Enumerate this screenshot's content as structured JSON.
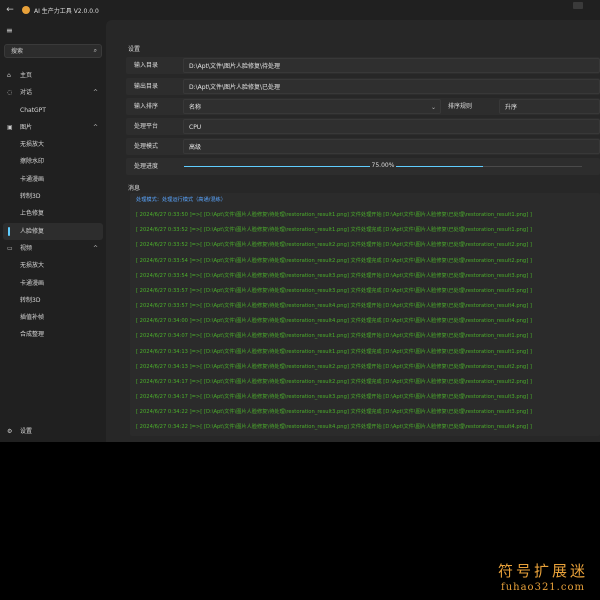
{
  "window": {
    "title": "AI 生产力工具 V2.0.0.0"
  },
  "sidebar": {
    "search_placeholder": "搜索",
    "items": [
      {
        "label": "主页",
        "icon": "home-icon"
      },
      {
        "label": "对话",
        "icon": "chat-icon"
      },
      {
        "label": "ChatGPT"
      },
      {
        "label": "图片",
        "icon": "image-icon"
      },
      {
        "label": "无损放大"
      },
      {
        "label": "擦除水印"
      },
      {
        "label": "卡通漫画"
      },
      {
        "label": "转制3D"
      },
      {
        "label": "上色修复"
      },
      {
        "label": "人脸修复"
      },
      {
        "label": "视频",
        "icon": "video-icon"
      },
      {
        "label": "无损放大"
      },
      {
        "label": "卡通漫画"
      },
      {
        "label": "转制3D"
      },
      {
        "label": "插值补帧"
      },
      {
        "label": "合成整理"
      }
    ],
    "settings_label": "设置"
  },
  "main": {
    "settings_title": "设置",
    "input_dir_label": "输入目录",
    "input_dir_value": "D:\\Apt\\文件\\图片人脸修复\\待处理",
    "output_dir_label": "输出目录",
    "output_dir_value": "D:\\Apt\\文件\\图片人脸修复\\已处理",
    "sort_label": "输入排序",
    "sort_value": "名称",
    "sort_rule_label": "排序规则",
    "sort_rule_value": "升序",
    "platform_label": "处理平台",
    "platform_value": "CPU",
    "mode_label": "处理模式",
    "mode_value": "高级",
    "progress_label": "处理进度",
    "progress_text": "75.00%",
    "progress_fraction": 0.75,
    "messages_title": "消息"
  },
  "log": [
    {
      "type": "info",
      "text": "处理模式：处理运行模式（高通/混练）"
    },
    {
      "type": "ok",
      "text": "[ 2024/6/27 0:33:50 ]=>[ [D:\\Apt\\文件\\图片人脸修复\\待处理\\restoration_result1.png] 文件处理开始 [D:\\Apt\\文件\\图片人脸修复\\已处理\\restoration_result1.png] ]"
    },
    {
      "type": "ok",
      "text": "[ 2024/6/27 0:33:52 ]=>[ [D:\\Apt\\文件\\图片人脸修复\\待处理\\restoration_result1.png] 文件处理完成 [D:\\Apt\\文件\\图片人脸修复\\已处理\\restoration_result1.png] ]"
    },
    {
      "type": "ok",
      "text": "[ 2024/6/27 0:33:52 ]=>[ [D:\\Apt\\文件\\图片人脸修复\\待处理\\restoration_result2.png] 文件处理开始 [D:\\Apt\\文件\\图片人脸修复\\已处理\\restoration_result2.png] ]"
    },
    {
      "type": "ok",
      "text": "[ 2024/6/27 0:33:54 ]=>[ [D:\\Apt\\文件\\图片人脸修复\\待处理\\restoration_result2.png] 文件处理完成 [D:\\Apt\\文件\\图片人脸修复\\已处理\\restoration_result2.png] ]"
    },
    {
      "type": "ok",
      "text": "[ 2024/6/27 0:33:54 ]=>[ [D:\\Apt\\文件\\图片人脸修复\\待处理\\restoration_result3.png] 文件处理开始 [D:\\Apt\\文件\\图片人脸修复\\已处理\\restoration_result3.png] ]"
    },
    {
      "type": "ok",
      "text": "[ 2024/6/27 0:33:57 ]=>[ [D:\\Apt\\文件\\图片人脸修复\\待处理\\restoration_result3.png] 文件处理完成 [D:\\Apt\\文件\\图片人脸修复\\已处理\\restoration_result3.png] ]"
    },
    {
      "type": "ok",
      "text": "[ 2024/6/27 0:33:57 ]=>[ [D:\\Apt\\文件\\图片人脸修复\\待处理\\restoration_result4.png] 文件处理开始 [D:\\Apt\\文件\\图片人脸修复\\已处理\\restoration_result4.png] ]"
    },
    {
      "type": "ok",
      "text": "[ 2024/6/27 0:34:00 ]=>[ [D:\\Apt\\文件\\图片人脸修复\\待处理\\restoration_result4.png] 文件处理完成 [D:\\Apt\\文件\\图片人脸修复\\已处理\\restoration_result4.png] ]"
    },
    {
      "type": "ok",
      "text": "[ 2024/6/27 0:34:07 ]=>[ [D:\\Apt\\文件\\图片人脸修复\\待处理\\restoration_result1.png] 文件处理开始 [D:\\Apt\\文件\\图片人脸修复\\已处理\\restoration_result1.png] ]"
    },
    {
      "type": "ok",
      "text": "[ 2024/6/27 0:34:13 ]=>[ [D:\\Apt\\文件\\图片人脸修复\\待处理\\restoration_result1.png] 文件处理完成 [D:\\Apt\\文件\\图片人脸修复\\已处理\\restoration_result1.png] ]"
    },
    {
      "type": "ok",
      "text": "[ 2024/6/27 0:34:13 ]=>[ [D:\\Apt\\文件\\图片人脸修复\\待处理\\restoration_result2.png] 文件处理开始 [D:\\Apt\\文件\\图片人脸修复\\已处理\\restoration_result2.png] ]"
    },
    {
      "type": "ok",
      "text": "[ 2024/6/27 0:34:17 ]=>[ [D:\\Apt\\文件\\图片人脸修复\\待处理\\restoration_result2.png] 文件处理完成 [D:\\Apt\\文件\\图片人脸修复\\已处理\\restoration_result2.png] ]"
    },
    {
      "type": "ok",
      "text": "[ 2024/6/27 0:34:17 ]=>[ [D:\\Apt\\文件\\图片人脸修复\\待处理\\restoration_result3.png] 文件处理开始 [D:\\Apt\\文件\\图片人脸修复\\已处理\\restoration_result3.png] ]"
    },
    {
      "type": "ok",
      "text": "[ 2024/6/27 0:34:22 ]=>[ [D:\\Apt\\文件\\图片人脸修复\\待处理\\restoration_result3.png] 文件处理完成 [D:\\Apt\\文件\\图片人脸修复\\已处理\\restoration_result3.png] ]"
    },
    {
      "type": "ok",
      "text": "[ 2024/6/27 0:34:22 ]=>[ [D:\\Apt\\文件\\图片人脸修复\\待处理\\restoration_result4.png] 文件处理开始 [D:\\Apt\\文件\\图片人脸修复\\已处理\\restoration_result4.png] ]"
    }
  ],
  "watermark": {
    "cn": "符号扩展迷",
    "en": "fuhao321.com"
  },
  "colors": {
    "accent": "#60cdff",
    "log_ok": "#4caf2c",
    "log_info": "#5aa6ff",
    "watermark": "#e8a13a"
  }
}
